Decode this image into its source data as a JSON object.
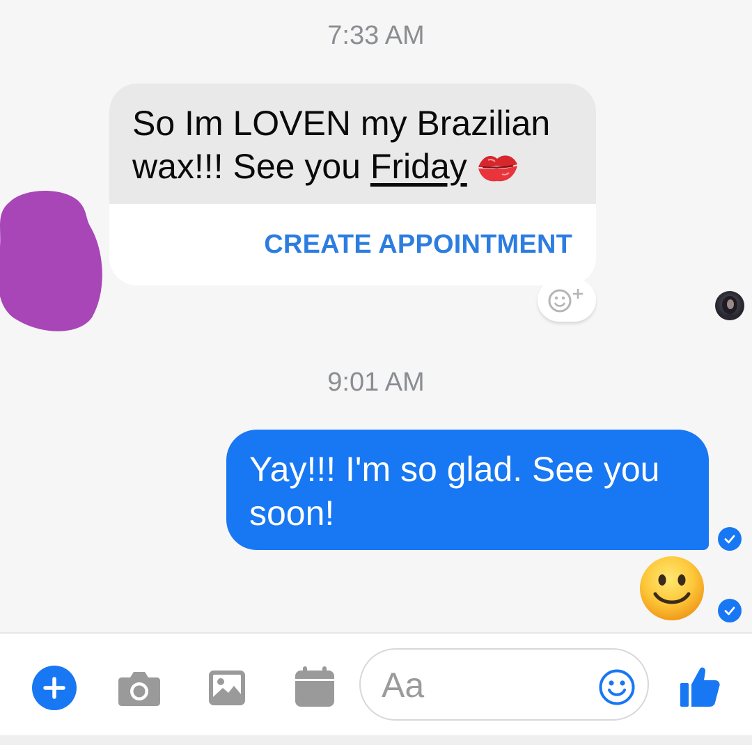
{
  "conversation": {
    "timestamps": [
      "7:33 AM",
      "9:01 AM"
    ],
    "incoming_message": {
      "text_before_link": "So Im LOVEN my Brazilian wax!!! See you ",
      "link_text": "Friday",
      "emoji": "kiss-mark",
      "action_label": "CREATE APPOINTMENT"
    },
    "outgoing_message": {
      "text": "Yay!!! I'm so glad. See you soon!",
      "emoji": "slightly-smiling-face"
    }
  },
  "composer": {
    "placeholder": "Aa",
    "tools": [
      "plus-icon",
      "camera-icon",
      "image-icon",
      "calendar-icon"
    ],
    "send_icon": "thumbs-up-icon"
  },
  "colors": {
    "accent": "#1877f2",
    "action_link": "#2d7de0",
    "incoming_bubble": "#e9e9ea",
    "timestamp": "#8a8d91",
    "icon_gray": "#9a9a9a",
    "redaction": "#a846b8"
  }
}
